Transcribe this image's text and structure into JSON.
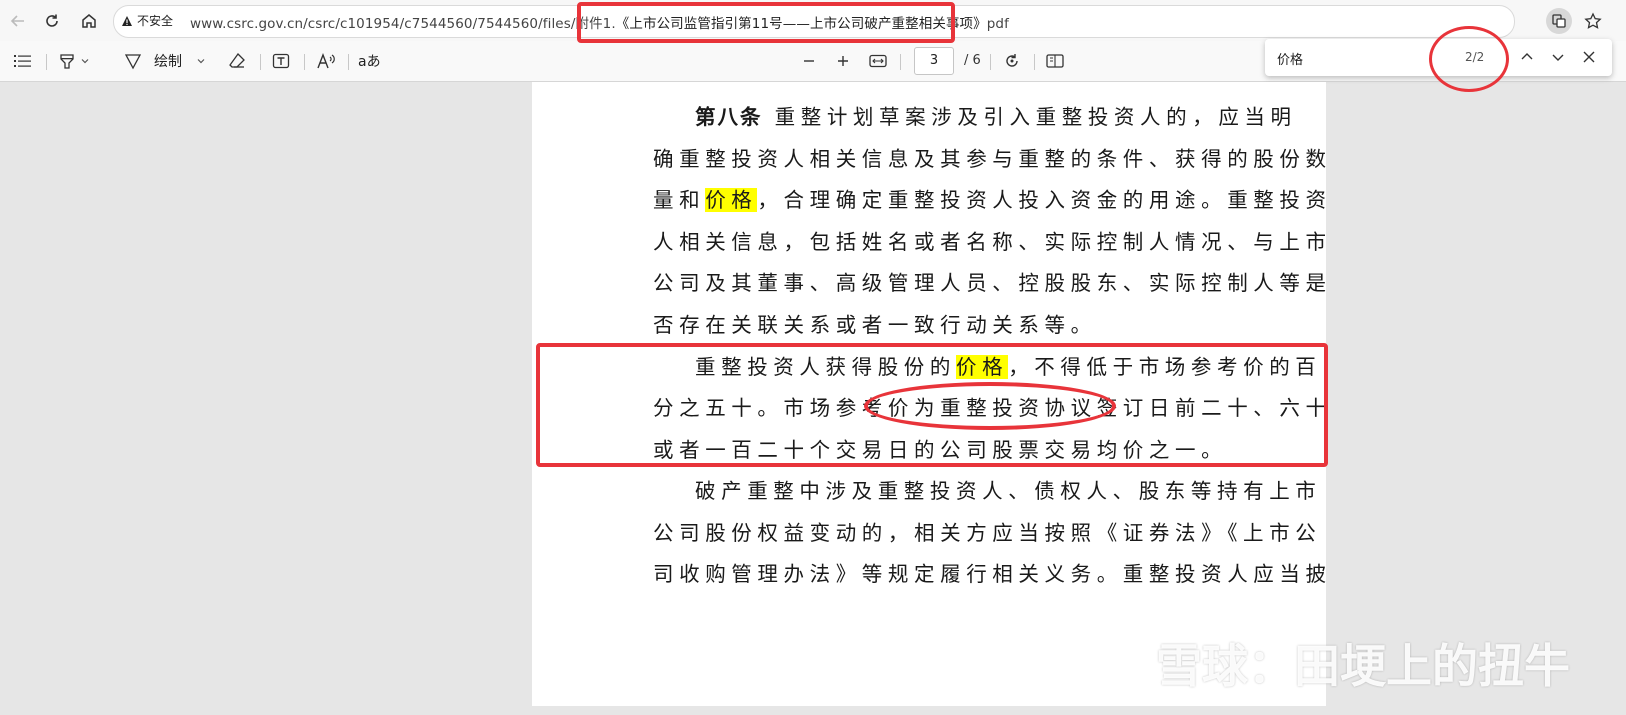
{
  "browser": {
    "security_label": "不安全",
    "url_prefix": "www.csrc.gov.cn/csrc/c101954/c7544560/7544560/files/附件1.",
    "url_title": "《上市公司监管指引第11号——上市公司破产重整相关事项》",
    "url_suffix": "pdf"
  },
  "toolbar": {
    "draw_label": "绘制",
    "page_current": "3",
    "page_total": "/ 6",
    "read_aloud_label": "Aᴬ",
    "immersive_label": "aあ"
  },
  "find": {
    "query": "价格",
    "count": "2/2"
  },
  "document": {
    "p1_line1_bold": "第八条",
    "p1_line1_rest": " 重整计划草案涉及引入重整投资人的，应当明",
    "p1_line2": "确重整投资人相关信息及其参与重整的条件、获得的股份数",
    "p1_line3_a": "量和",
    "p1_line3_hl": "价格",
    "p1_line3_b": "，合理确定重整投资人投入资金的用途。重整投资",
    "p1_line4": "人相关信息，包括姓名或者名称、实际控制人情况、与上市",
    "p1_line5": "公司及其董事、高级管理人员、控股股东、实际控制人等是",
    "p1_line6": "否存在关联关系或者一致行动关系等。",
    "p2_line1_a": "重整投资人获得股份的",
    "p2_line1_hl": "价格",
    "p2_line1_b": "，不得低于市场参考价的百",
    "p2_line2": "分之五十。市场参考价为重整投资协议签订日前二十、六十",
    "p2_line3": "或者一百二十个交易日的公司股票交易均价之一。",
    "p3_line1": "破产重整中涉及重整投资人、债权人、股东等持有上市",
    "p3_line2": "公司股份权益变动的，相关方应当按照《证券法》《上市公",
    "p3_line3": "司收购管理办法》等规定履行相关义务。重整投资人应当披"
  },
  "watermark": {
    "text": "雪球：田埂上的扭牛"
  },
  "colors": {
    "highlight": "#ffff00",
    "annotation": "#e8343a"
  }
}
